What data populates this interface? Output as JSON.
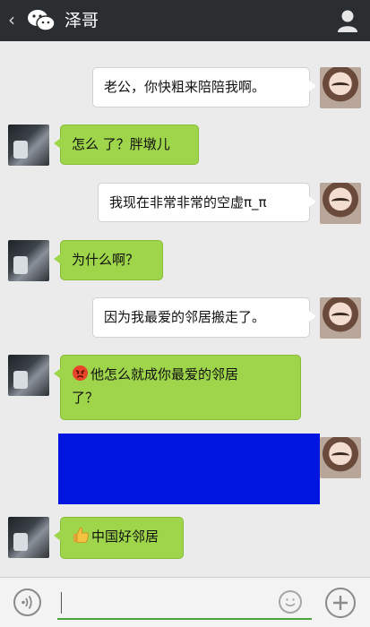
{
  "header": {
    "title": "泽哥"
  },
  "icons": {
    "back": "chevron-left-icon",
    "app": "wechat-logo-icon",
    "contact": "person-icon",
    "voice": "voice-icon",
    "emoji": "smiley-icon",
    "more": "plus-icon",
    "angry": "angry-face-icon",
    "thumbs": "thumbs-up-icon"
  },
  "colors": {
    "topbar": "#2a2e31",
    "chat_bg": "#ebebeb",
    "sent_bubble": "#fefefe",
    "received_bubble": "#9ed54a",
    "redaction_block": "#0016e0",
    "input_underline": "#4aa63a"
  },
  "messages": [
    {
      "sender": "me",
      "text": "老公，你快粗来陪陪我啊。"
    },
    {
      "sender": "泽哥",
      "text": "怎么 了？胖墩儿"
    },
    {
      "sender": "me",
      "text": "我现在非常非常的空虚π_π"
    },
    {
      "sender": "泽哥",
      "text": "为什么啊？"
    },
    {
      "sender": "me",
      "text": "因为我最爱的邻居搬走了。"
    },
    {
      "sender": "泽哥",
      "text_line1": "他怎么就成你最爱的邻居",
      "text_line2": "了？",
      "emoji": "angry-face"
    },
    {
      "sender": "me",
      "redacted": true
    },
    {
      "sender": "泽哥",
      "text": "中国好邻居",
      "emoji": "thumbs-up"
    }
  ],
  "input": {
    "value": "",
    "placeholder": ""
  }
}
